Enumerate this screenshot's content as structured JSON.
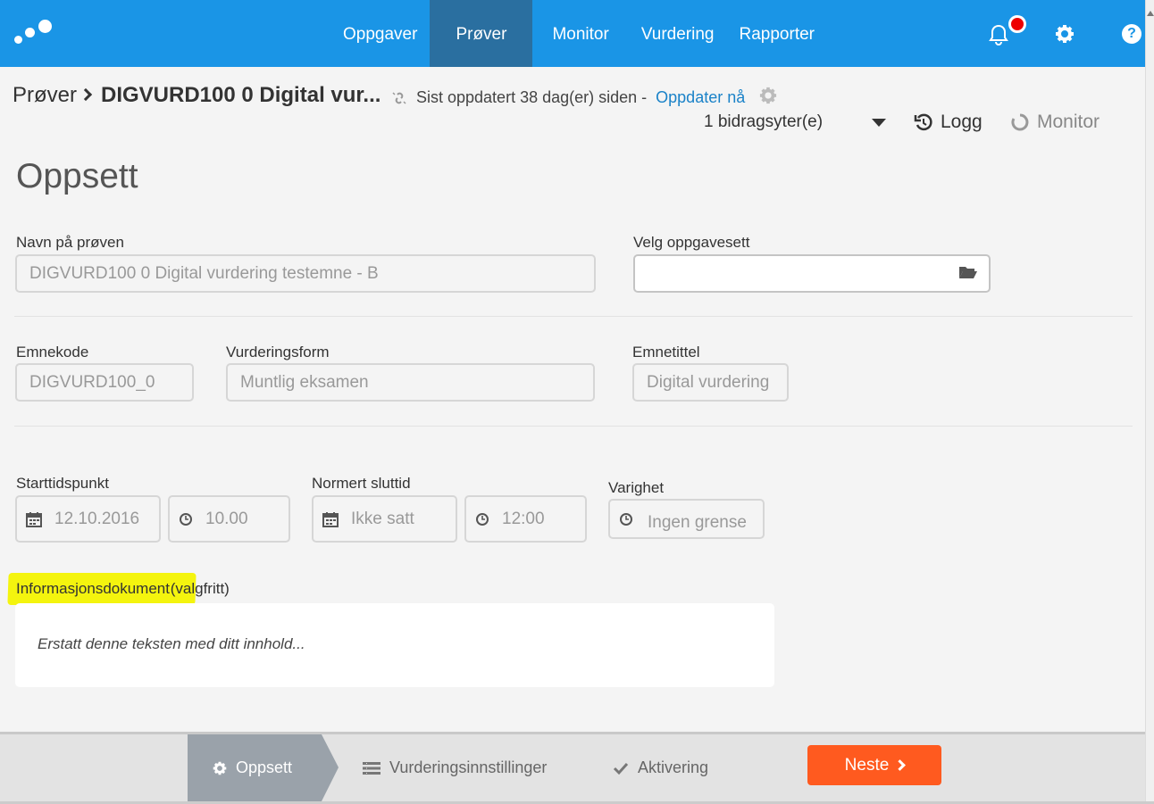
{
  "nav": {
    "items": [
      {
        "label": "Oppgaver"
      },
      {
        "label": "Prøver"
      },
      {
        "label": "Monitor"
      },
      {
        "label": "Vurdering"
      },
      {
        "label": "Rapporter"
      }
    ],
    "active": "Prøver",
    "help_label": "?"
  },
  "breadcrumb": {
    "root": "Prøver",
    "current": "DIGVURD100 0 Digital vur..."
  },
  "sync": {
    "status": "Sist oppdatert 38 dag(er) siden -",
    "update_link": "Oppdater nå"
  },
  "toolbar": {
    "contributors": "1 bidragsyter(e)",
    "log_label": "Logg",
    "monitor_label": "Monitor"
  },
  "page_title": "Oppsett",
  "form": {
    "test_name": {
      "label": "Navn på prøven",
      "value": "DIGVURD100 0 Digital vurdering testemne - B"
    },
    "task_set": {
      "label": "Velg oppgavesett",
      "value": ""
    },
    "course_code": {
      "label": "Emnekode",
      "value": "DIGVURD100_0"
    },
    "assessment_form": {
      "label": "Vurderingsform",
      "value": "Muntlig eksamen"
    },
    "course_title": {
      "label": "Emnetittel",
      "value": "Digital vurdering"
    },
    "start": {
      "label": "Starttidspunkt",
      "date": "12.10.2016",
      "time": "10.00"
    },
    "end": {
      "label": "Normert sluttid",
      "date": "Ikke satt",
      "time": "12:00"
    },
    "duration": {
      "label": "Varighet",
      "value": "Ingen grense"
    },
    "info_doc": {
      "label": "Informasjonsdokument",
      "optional": "(valgfritt)",
      "content": "Erstatt denne teksten med ditt innhold..."
    }
  },
  "wizard": {
    "steps": [
      {
        "label": "Oppsett"
      },
      {
        "label": "Vurderingsinnstillinger"
      },
      {
        "label": "Aktivering"
      }
    ],
    "next_label": "Neste"
  },
  "colors": {
    "nav_bg": "#1a95e6",
    "nav_active": "#2a6fa0",
    "link": "#1a82c8",
    "next_button": "#ff5a1f",
    "highlight": "#f4f40e",
    "notification_dot": "#ee0000"
  }
}
